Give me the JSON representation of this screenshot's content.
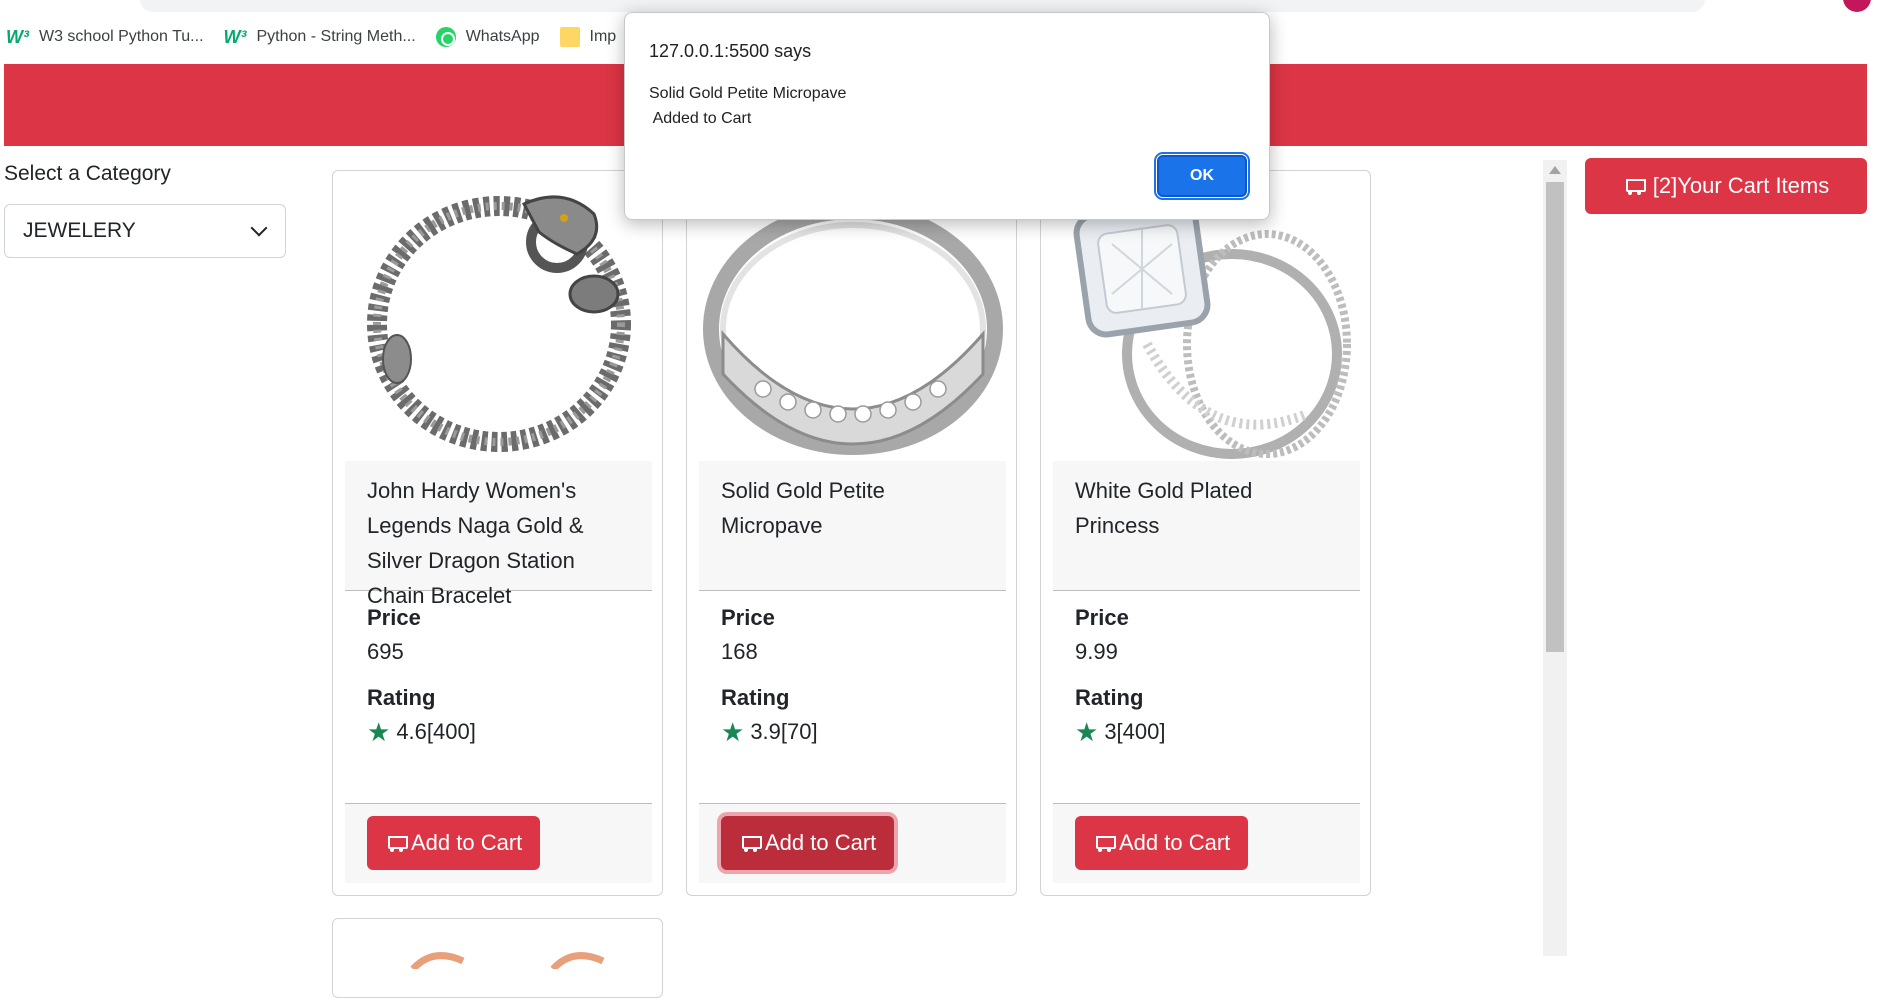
{
  "bookmarks": [
    {
      "label": "W3 school Python Tu...",
      "icon": "w3-icon"
    },
    {
      "label": "Python - String Meth...",
      "icon": "w3-icon"
    },
    {
      "label": "WhatsApp",
      "icon": "whatsapp-icon"
    },
    {
      "label": "Imp",
      "icon": "folder-icon"
    }
  ],
  "sidebar": {
    "category_label": "Select a Category",
    "selected_category": "JEWELERY"
  },
  "products": [
    {
      "title": "John Hardy Women's Legends Naga Gold & Silver Dragon Station Chain Bracelet",
      "price_label": "Price",
      "price": "695",
      "rating_label": "Rating",
      "rating": "4.6[400]",
      "button": "Add to Cart"
    },
    {
      "title": "Solid Gold Petite Micropave",
      "price_label": "Price",
      "price": "168",
      "rating_label": "Rating",
      "rating": "3.9[70]",
      "button": "Add to Cart"
    },
    {
      "title": "White Gold Plated Princess",
      "price_label": "Price",
      "price": "9.99",
      "rating_label": "Rating",
      "rating": "3[400]",
      "button": "Add to Cart"
    }
  ],
  "cart": {
    "label": "[2]Your Cart Items"
  },
  "alert": {
    "origin": "127.0.0.1:5500 says",
    "message": "Solid Gold Petite Micropave\n Added to Cart",
    "ok": "OK"
  },
  "colors": {
    "brand_red": "#dc3545",
    "rating_star": "#198754",
    "dialog_blue": "#1a73e8"
  }
}
